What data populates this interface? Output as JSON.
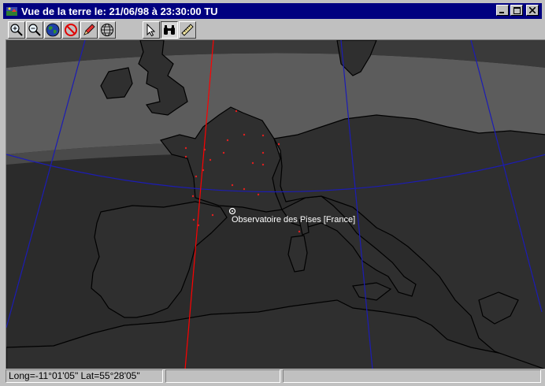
{
  "window": {
    "title": "Vue de la terre le: 21/06/98 à 23:30:00 TU",
    "buttons": [
      "minimize",
      "maximize",
      "close"
    ]
  },
  "toolbar": {
    "tools": [
      {
        "name": "zoom-in-tool",
        "icon": "magnifier-plus-icon"
      },
      {
        "name": "zoom-out-tool",
        "icon": "magnifier-minus-icon"
      },
      {
        "name": "globe-view-tool",
        "icon": "earth-globe-icon"
      },
      {
        "name": "no-entry-tool",
        "icon": "prohibited-icon"
      },
      {
        "name": "pencil-tool",
        "icon": "pencil-icon"
      },
      {
        "name": "grid-globe-tool",
        "icon": "wireframe-globe-icon"
      },
      {
        "name": "pointer-tool",
        "icon": "arrow-cursor-icon"
      },
      {
        "name": "binoculars-tool",
        "icon": "binoculars-icon",
        "active": true
      },
      {
        "name": "ruler-tool",
        "icon": "ruler-icon"
      }
    ]
  },
  "map": {
    "observatory_label": "Observatoire des Pises [France]",
    "colors": {
      "night": "#2b2b2b",
      "twilight_dark": "#4a4a4a",
      "twilight_light": "#5c5c5c",
      "coastline": "#000000",
      "meridians": "#1c1cb4",
      "track": "#ff0000",
      "markers": "#e02020"
    }
  },
  "status": {
    "coordinates": "Long=-11°01'05\"  Lat=55°28'05\"",
    "panel2": "",
    "panel3": ""
  }
}
